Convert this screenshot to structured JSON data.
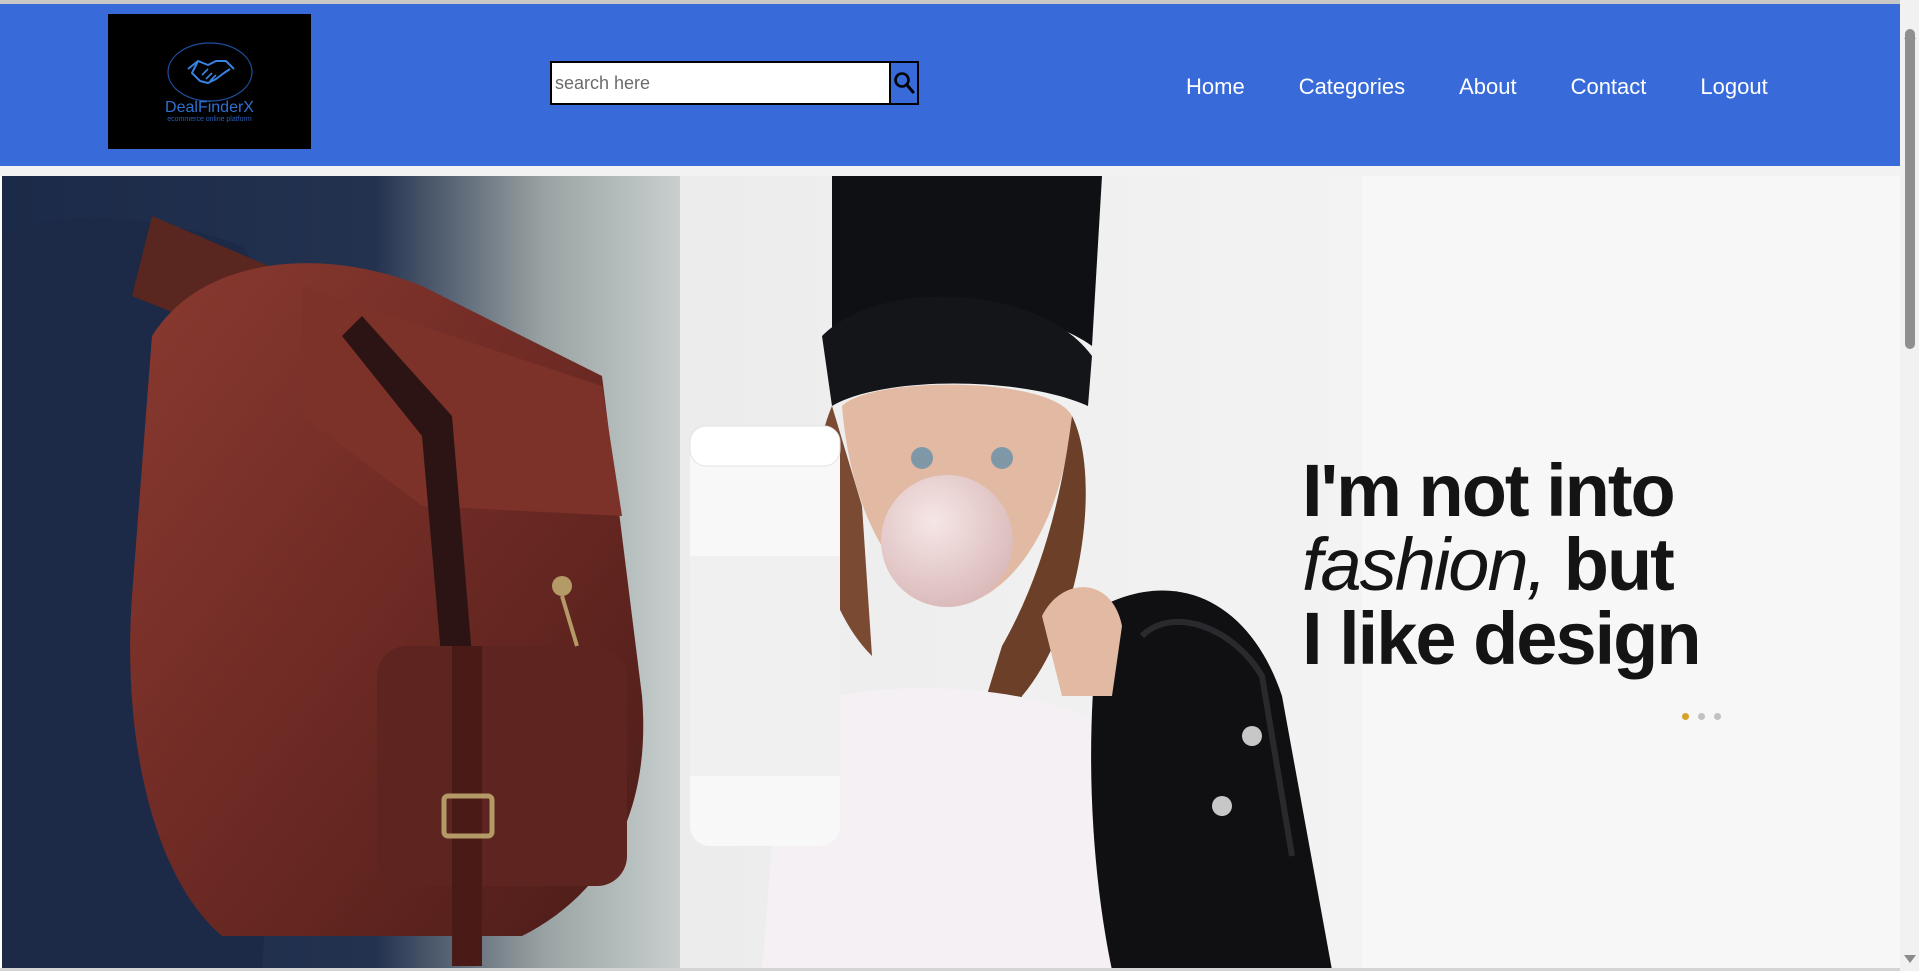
{
  "brand": {
    "name": "DealFinderX",
    "tagline": "ecommerce online platform",
    "logo_icon": "handshake-icon"
  },
  "search": {
    "placeholder": "search here",
    "value": "",
    "icon": "search-icon"
  },
  "nav": {
    "home": "Home",
    "categories": "Categories",
    "about": "About",
    "contact": "Contact",
    "logout": "Logout"
  },
  "hero": {
    "headline_line1": "I'm not into",
    "headline_line2_italic": "fashion,",
    "headline_line2_rest": " but",
    "headline_line3": "I like design",
    "slides_total": 3,
    "active_slide": 1
  },
  "colors": {
    "navbar": "#386bd9",
    "logo_bg": "#000000",
    "dot_active": "#d8a12a",
    "dot_inactive": "#c2c2c2",
    "nav_text": "#ffffff"
  }
}
